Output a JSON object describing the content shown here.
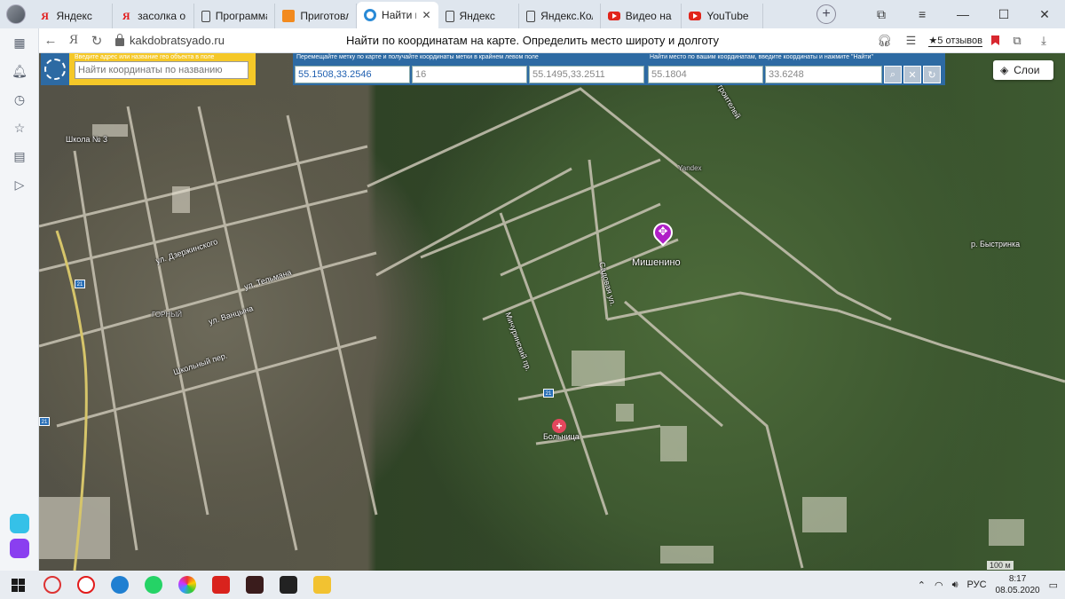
{
  "browser": {
    "tabs": [
      {
        "label": "Яндекс",
        "favicon": "ya-icon"
      },
      {
        "label": "засолка огурцов",
        "favicon": "ya-icon"
      },
      {
        "label": "Программа передач",
        "favicon": "doc-icon"
      },
      {
        "label": "Приготовление",
        "favicon": "orange-icon"
      },
      {
        "label": "Найти по координатам",
        "favicon": "site-icon",
        "active": true
      },
      {
        "label": "Яндекс",
        "favicon": "doc-icon"
      },
      {
        "label": "Яндекс.Коллекции",
        "favicon": "doc-icon"
      },
      {
        "label": "Видео на канале",
        "favicon": "youtube-icon"
      },
      {
        "label": "YouTube",
        "favicon": "youtube-icon"
      }
    ],
    "tab_close": "✕",
    "new_tab": "+",
    "address": {
      "back": "←",
      "logo": "Я",
      "reload": "↻",
      "domain": "kakdobratsyado.ru",
      "page_title": "Найти по координатам на карте. Определить место широту и долготу",
      "reviews": "★5 отзывов"
    }
  },
  "page": {
    "search_panel": {
      "hint": "Введите адрес или название гео объекта в поле",
      "placeholder": "Найти координаты по названию"
    },
    "marker_panel": {
      "hint": "Перемещайте метку по карте и получайте координаты метки в крайнем левом поле",
      "coords": "55.1508,33.2546",
      "zoom": "16",
      "top_left": "55.1495,33.2511"
    },
    "find_panel": {
      "hint": "Найти место по вашим координатам, введите координаты и нажмите \"Найти\"",
      "lat": "55.1804",
      "lon": "33.6248"
    },
    "layers_label": "Слои"
  },
  "map": {
    "labels": [
      {
        "text": "Мишенино",
        "kind": "place"
      },
      {
        "text": "Больница",
        "kind": "poi"
      },
      {
        "text": "р. Быстринка",
        "kind": "river"
      },
      {
        "text": "ГОРНЫЙ",
        "kind": "district"
      },
      {
        "text": "Школа № 3",
        "kind": "poi"
      },
      {
        "text": "ул. Дзержинского",
        "kind": "street"
      },
      {
        "text": "ул. Тельмана",
        "kind": "street"
      },
      {
        "text": "ул. Ванцына",
        "kind": "street"
      },
      {
        "text": "Школьный пер.",
        "kind": "street"
      },
      {
        "text": "Мичуринский пр.",
        "kind": "street"
      },
      {
        "text": "Садовая ул.",
        "kind": "street"
      },
      {
        "text": "ул. Строителей",
        "kind": "street"
      },
      {
        "text": "Yandex",
        "kind": "watermark"
      }
    ],
    "road_signs": [
      "21",
      "21",
      "21"
    ],
    "scale": "100 м"
  },
  "taskbar": {
    "lang": "РУС",
    "time": "8:17",
    "date": "08.05.2020"
  }
}
